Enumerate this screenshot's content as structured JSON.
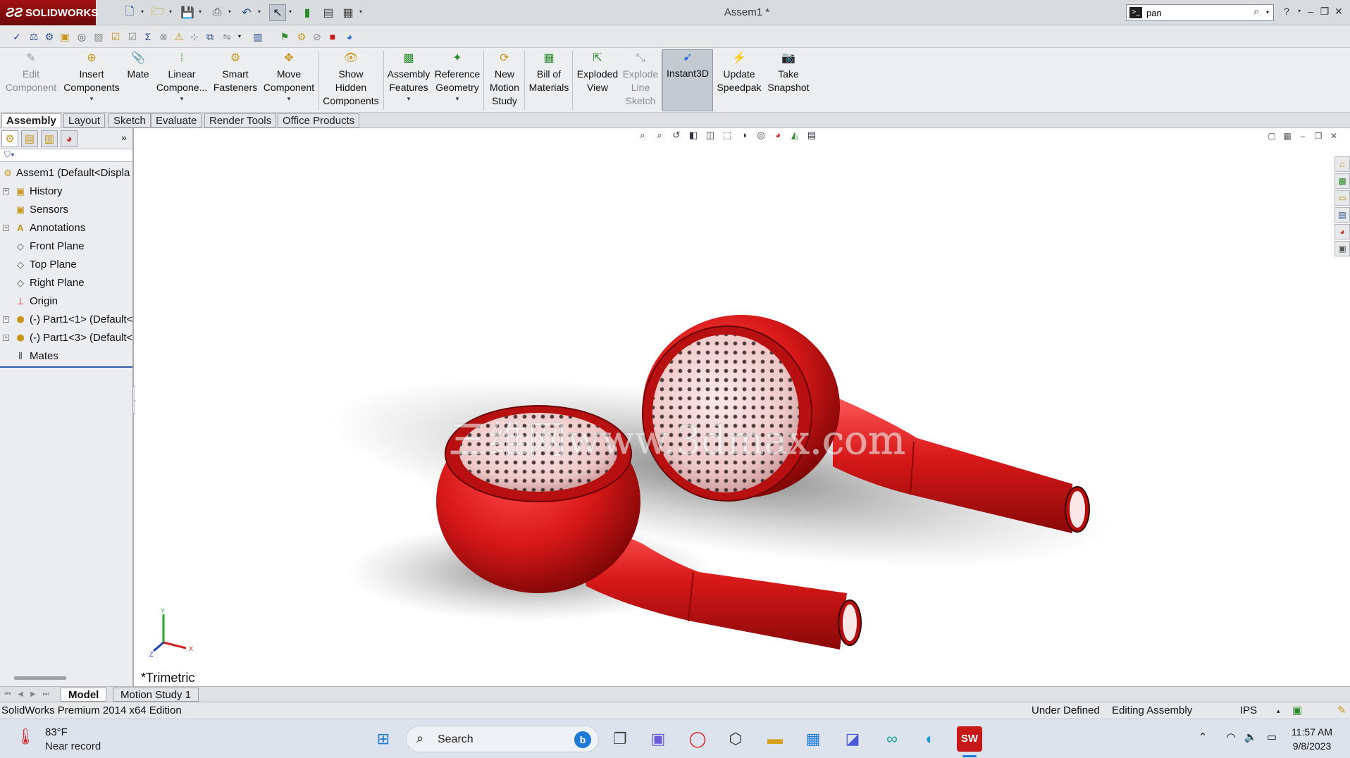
{
  "app": {
    "logo_text": "SOLIDWORKS",
    "document_title": "Assem1 *",
    "search": {
      "value": "pan",
      "placeholder": ""
    }
  },
  "command_manager": {
    "buttons": [
      {
        "label": "Edit\nComponent",
        "icon": "edit-component-icon"
      },
      {
        "label": "Insert\nComponents",
        "icon": "insert-components-icon"
      },
      {
        "label": "Mate",
        "icon": "mate-icon"
      },
      {
        "label": "Linear\nCompone...",
        "icon": "linear-pattern-icon"
      },
      {
        "label": "Smart\nFasteners",
        "icon": "smart-fasteners-icon"
      },
      {
        "label": "Move\nComponent",
        "icon": "move-component-icon"
      },
      {
        "label": "Show\nHidden\nComponents",
        "icon": "show-hidden-icon"
      },
      {
        "label": "Assembly\nFeatures",
        "icon": "assembly-features-icon"
      },
      {
        "label": "Reference\nGeometry",
        "icon": "reference-geometry-icon"
      },
      {
        "label": "New\nMotion\nStudy",
        "icon": "motion-study-icon"
      },
      {
        "label": "Bill of\nMaterials",
        "icon": "bom-icon"
      },
      {
        "label": "Exploded\nView",
        "icon": "exploded-view-icon"
      },
      {
        "label": "Explode\nLine\nSketch",
        "icon": "explode-line-icon"
      },
      {
        "label": "Instant3D",
        "icon": "instant3d-icon"
      },
      {
        "label": "Update\nSpeedpak",
        "icon": "speedpak-icon"
      },
      {
        "label": "Take\nSnapshot",
        "icon": "snapshot-icon"
      }
    ]
  },
  "tabs": [
    "Assembly",
    "Layout",
    "Sketch",
    "Evaluate",
    "Render Tools",
    "Office Products"
  ],
  "feature_tree": {
    "root": "Assem1  (Default<Displa",
    "items": [
      {
        "label": "History",
        "expandable": true,
        "icon": "history-folder-icon"
      },
      {
        "label": "Sensors",
        "expandable": false,
        "icon": "sensors-folder-icon"
      },
      {
        "label": "Annotations",
        "expandable": true,
        "icon": "annotations-icon"
      },
      {
        "label": "Front Plane",
        "expandable": false,
        "icon": "plane-icon"
      },
      {
        "label": "Top Plane",
        "expandable": false,
        "icon": "plane-icon"
      },
      {
        "label": "Right Plane",
        "expandable": false,
        "icon": "plane-icon"
      },
      {
        "label": "Origin",
        "expandable": false,
        "icon": "origin-icon"
      },
      {
        "label": "(-) Part1<1> (Default<",
        "expandable": true,
        "icon": "part-icon"
      },
      {
        "label": "(-) Part1<3> (Default<",
        "expandable": true,
        "icon": "part-icon"
      },
      {
        "label": "Mates",
        "expandable": false,
        "icon": "mates-icon"
      }
    ]
  },
  "graphics": {
    "view_label": "*Trimetric",
    "watermark": "三维网www.3dmax.com",
    "part_color": "#d81818",
    "triad": {
      "x": "X",
      "y": "Y",
      "z": "Z"
    }
  },
  "model_tabs": [
    "Model",
    "Motion Study 1"
  ],
  "status": {
    "edition": "SolidWorks Premium 2014 x64 Edition",
    "definition": "Under Defined",
    "mode": "Editing Assembly",
    "units": "IPS"
  },
  "taskbar": {
    "weather_temp": "83°F",
    "weather_desc": "Near record",
    "search_label": "Search",
    "time": "11:57 AM",
    "date": "9/8/2023"
  }
}
